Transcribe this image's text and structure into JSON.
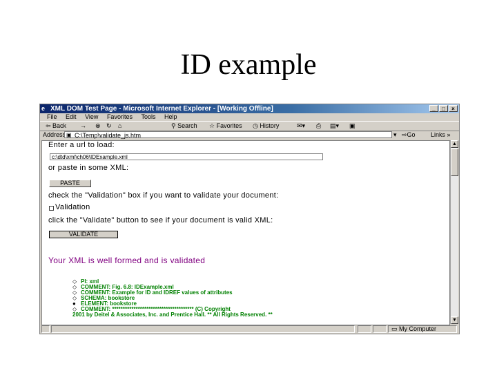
{
  "slide": {
    "title": "ID example"
  },
  "window": {
    "title": "XML DOM Test Page - Microsoft Internet Explorer - [Working Offline]",
    "buttons": {
      "minimize": "_",
      "maximize": "□",
      "close": "×"
    }
  },
  "menu": [
    "File",
    "Edit",
    "View",
    "Favorites",
    "Tools",
    "Help"
  ],
  "toolbar": {
    "back": "Back",
    "search": "Search",
    "favorites": "Favorites",
    "history": "History"
  },
  "address": {
    "label": "Address",
    "value": "C:\\Temp\\validate_js.htm",
    "go": "Go",
    "links": "Links »"
  },
  "page": {
    "enter_url_label": "Enter a url to load:",
    "url_value": "c:\\dtd\\xml\\ch06\\IDExample.xml",
    "paste_label": "or paste in some XML:",
    "paste_button": "PASTE",
    "check_instruction": "check the \"Validation\" box if you want to validate your document:",
    "validation_checkbox_label": "Validation",
    "click_instruction": "click the \"Validate\" button to see if your document is valid XML:",
    "validate_button": "VALIDATE",
    "result_message": "Your XML is well formed and is validated",
    "tree": [
      {
        "marker": "◇",
        "text": "PI: xml"
      },
      {
        "marker": "◇",
        "text": "COMMENT: Fig. 6.8: IDExample.xml"
      },
      {
        "marker": "◇",
        "text": "COMMENT: Example for ID and IDREF values of attributes"
      },
      {
        "marker": "◇",
        "text": "SCHEMA: bookstore"
      },
      {
        "marker": "●",
        "text": "ELEMENT: bookstore"
      },
      {
        "marker": "◇",
        "text": "COMMENT: ************************************** (C) Copyright"
      },
      {
        "marker": "",
        "text": "2001 by Deitel & Associates, Inc. and Prentice Hall. ** All Rights Reserved. **"
      }
    ]
  },
  "status": {
    "zone": "My Computer"
  }
}
